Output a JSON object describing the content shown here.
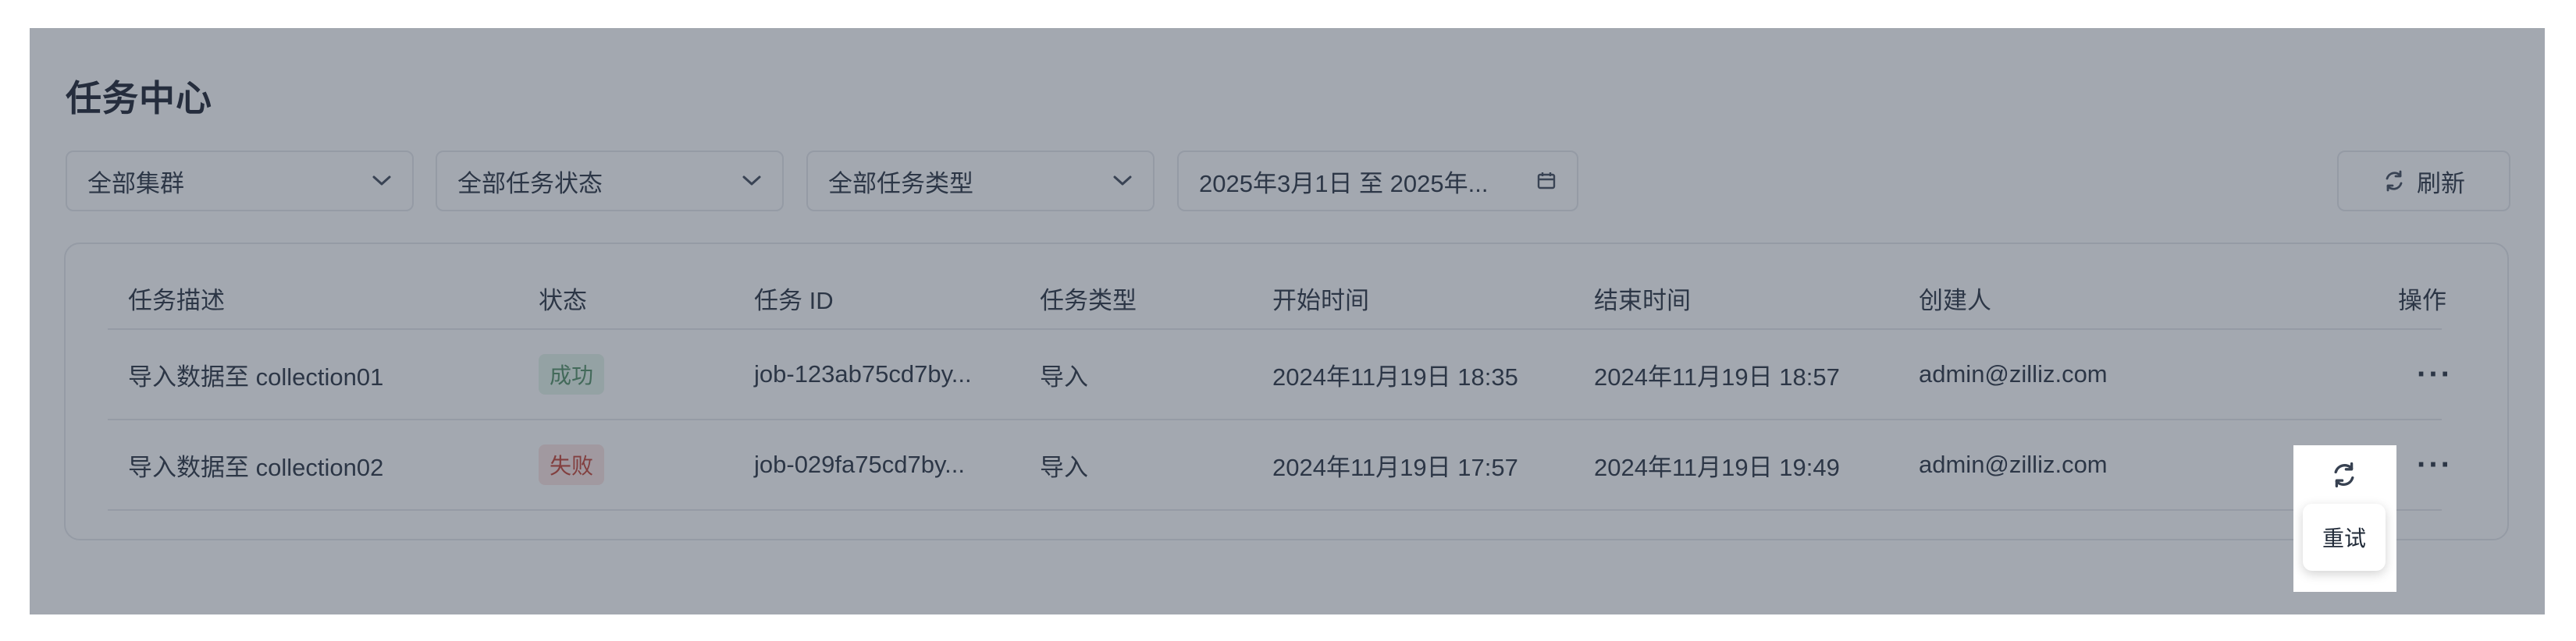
{
  "page": {
    "title": "任务中心"
  },
  "filters": {
    "cluster": "全部集群",
    "status": "全部任务状态",
    "type": "全部任务类型",
    "date_range": "2025年3月1日 至 2025年..."
  },
  "refresh_label": "刷新",
  "table": {
    "headers": [
      "任务描述",
      "状态",
      "任务 ID",
      "任务类型",
      "开始时间",
      "结束时间",
      "创建人",
      "操作"
    ],
    "rows": [
      {
        "description": "导入数据至 collection01",
        "status": "成功",
        "status_color": "#4a8a5e",
        "job_id": "job-123ab75cd7by...",
        "type": "导入",
        "start": "2024年11月19日 18:35",
        "end": "2024年11月19日 18:57",
        "creator": "admin@zilliz.com",
        "actions": "···"
      },
      {
        "description": "导入数据至 collection02",
        "status": "失败",
        "status_color": "#c0392b",
        "job_id": "job-029fa75cd7by...",
        "type": "导入",
        "start": "2024年11月19日 17:57",
        "end": "2024年11月19日 19:49",
        "creator": "admin@zilliz.com",
        "actions": "···"
      }
    ]
  },
  "tooltip": {
    "retry_label": "重试"
  },
  "colors": {
    "overlay": "#3c4658",
    "success_bg": "#e3f3e8",
    "fail_bg": "#fbe3e1"
  }
}
